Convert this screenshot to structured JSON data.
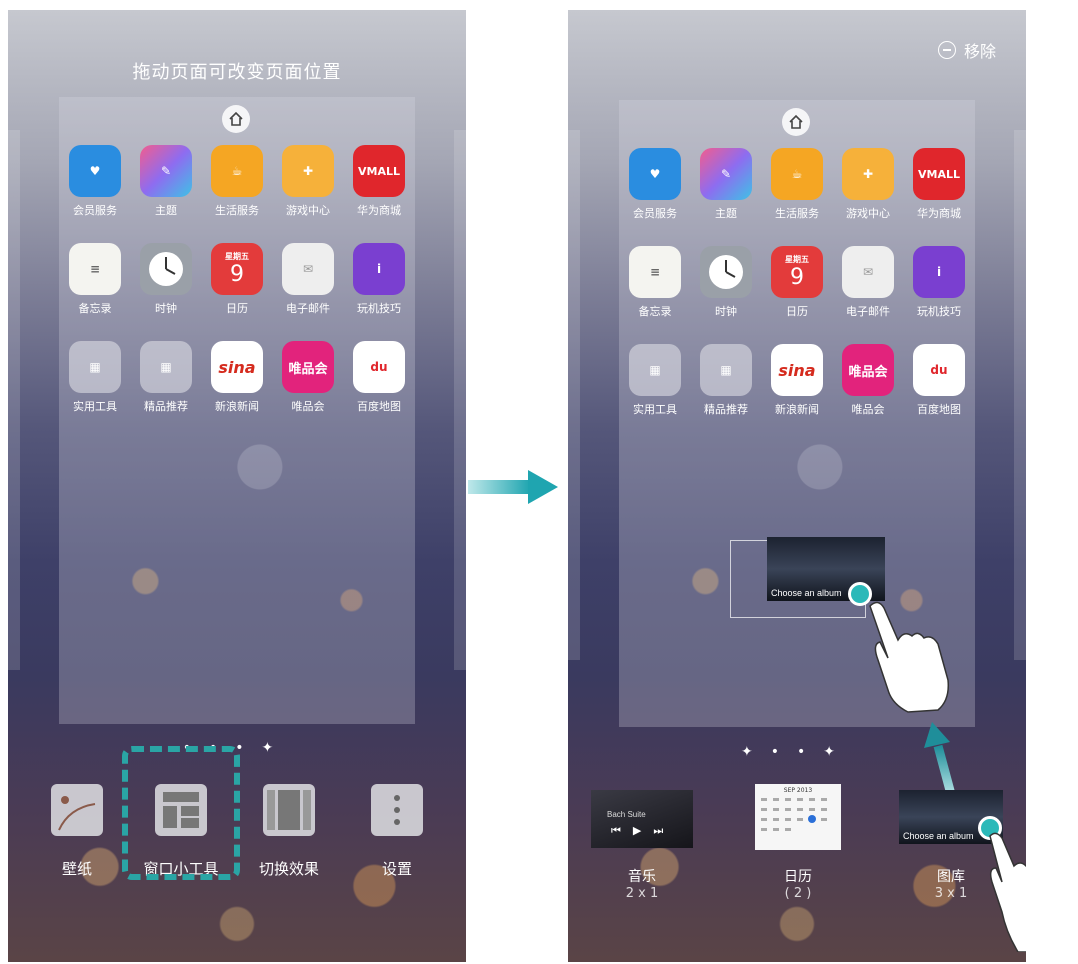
{
  "left": {
    "header": "拖动页面可改变页面位置",
    "apps": [
      "会员服务",
      "主题",
      "生活服务",
      "游戏中心",
      "华为商城",
      "备忘录",
      "时钟",
      "日历",
      "电子邮件",
      "玩机技巧",
      "实用工具",
      "精品推荐",
      "新浪新闻",
      "唯品会",
      "百度地图"
    ],
    "calendar_day": "星期五",
    "calendar_date": "9",
    "vmall": "VMALL",
    "sina": "sina",
    "vip": "唯品会",
    "baidu": "du",
    "bottom": [
      "壁纸",
      "窗口小工具",
      "切换效果",
      "设置"
    ]
  },
  "right": {
    "remove": "移除",
    "widgets": [
      {
        "name": "音乐",
        "size": "2 x 1",
        "title": "Bach Suite"
      },
      {
        "name": "日历",
        "size": "( 2 )",
        "title": "SEP 2013"
      },
      {
        "name": "图库",
        "size": "3 x 1",
        "title": "Choose an album"
      }
    ],
    "dragged_caption": "Choose an album"
  },
  "colors": {
    "accent": "#2aa5a5"
  }
}
